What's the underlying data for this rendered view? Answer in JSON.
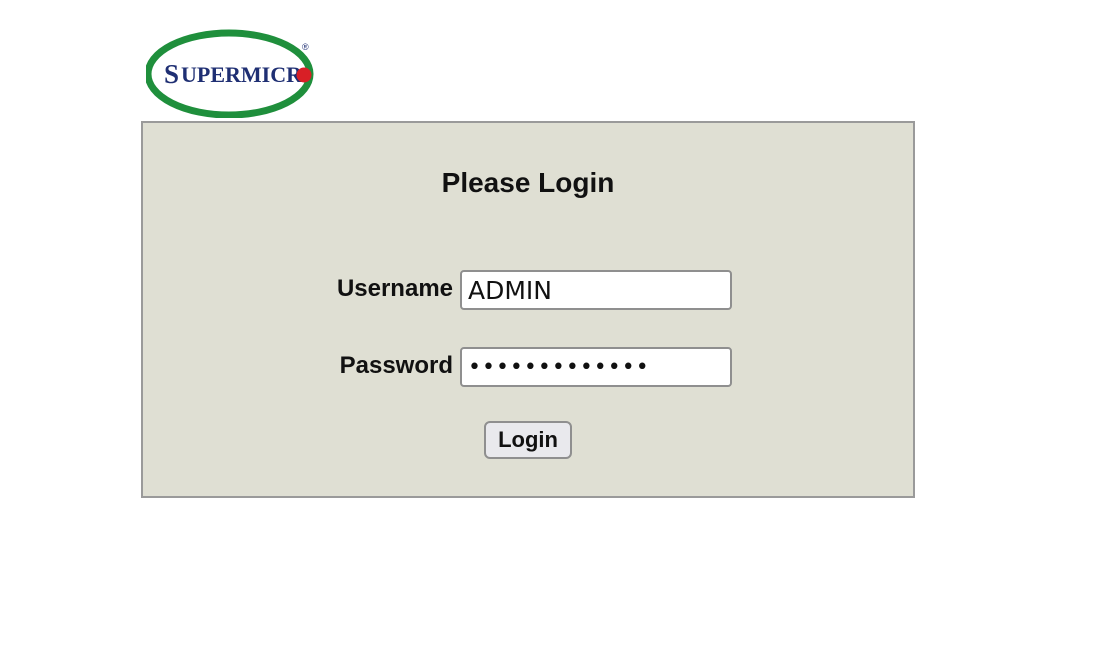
{
  "logo": {
    "text": "SUPERMICRO",
    "trademark": "®",
    "colors": {
      "ellipse": "#1f8f3c",
      "text": "#1f2f73",
      "dot": "#d81f26"
    }
  },
  "login": {
    "title": "Please Login",
    "username_label": "Username",
    "username_value": "ADMIN",
    "password_label": "Password",
    "password_value": "ADMINADMINADM",
    "button_label": "Login"
  },
  "colors": {
    "panel_background": "#dfdfd3",
    "panel_border": "#9a9a9a",
    "button_background": "#e9e9ed"
  }
}
